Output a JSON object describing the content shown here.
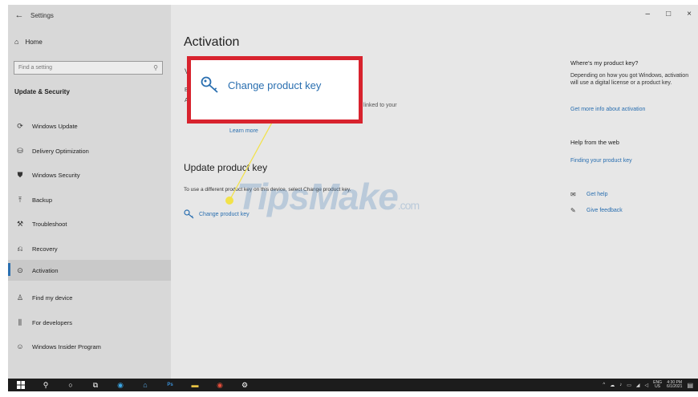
{
  "window": {
    "back_glyph": "←",
    "title": "Settings",
    "controls": [
      "–",
      "□",
      "×"
    ]
  },
  "sidebar": {
    "home_label": "Home",
    "search_placeholder": "Find a setting",
    "section_title": "Update & Security",
    "items": [
      {
        "label": "Windows Update",
        "icon": "refresh-icon",
        "glyph": "⟳"
      },
      {
        "label": "Delivery Optimization",
        "icon": "delivery-optimization-icon",
        "glyph": "⛁"
      },
      {
        "label": "Windows Security",
        "icon": "shield-icon",
        "glyph": "⛊"
      },
      {
        "label": "Backup",
        "icon": "backup-icon",
        "glyph": "⤒"
      },
      {
        "label": "Troubleshoot",
        "icon": "wrench-icon",
        "glyph": "⚒"
      },
      {
        "label": "Recovery",
        "icon": "recovery-icon",
        "glyph": "⎌"
      },
      {
        "label": "Activation",
        "icon": "activation-check-icon",
        "glyph": "⊙",
        "selected": true
      },
      {
        "label": "Find my device",
        "icon": "find-device-icon",
        "glyph": "♙"
      },
      {
        "label": "For developers",
        "icon": "developer-icon",
        "glyph": "⫼"
      },
      {
        "label": "Windows Insider Program",
        "icon": "insider-icon",
        "glyph": "☺"
      }
    ]
  },
  "main": {
    "title": "Activation",
    "partial_v": "V",
    "partial_e": "E",
    "partial_a": "A",
    "linked_text": "linked to your",
    "learn_more": "Learn more",
    "update_heading": "Update product key",
    "update_desc": "To use a different product key on this device, select Change product key.",
    "change_key_link": "Change product key"
  },
  "callout": {
    "label": "Change product key"
  },
  "right_panel": {
    "where_title": "Where's my product key?",
    "where_text": "Depending on how you got Windows, activation will use a digital license or a product key.",
    "get_more_info": "Get more info about activation",
    "help_title": "Help from the web",
    "finding_key": "Finding your product key",
    "get_help": "Get help",
    "give_feedback": "Give feedback"
  },
  "watermark": {
    "text": "TipsMake",
    "suffix": ".com"
  },
  "taskbar": {
    "lang_top": "ENG",
    "lang_bottom": "US",
    "time": "4:30 PM",
    "date": "6/1/2021"
  },
  "colors": {
    "accent": "#2a6fb0",
    "callout_border": "#d8232e",
    "pointer": "#f2e24a"
  }
}
